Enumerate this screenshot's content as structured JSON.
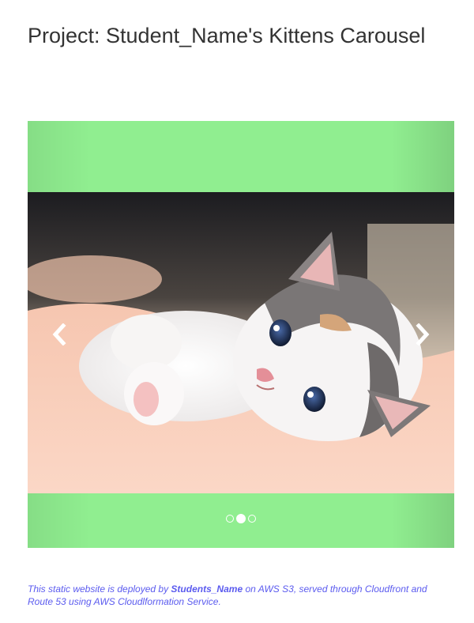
{
  "header": {
    "title": "Project: Student_Name's Kittens Carousel"
  },
  "carousel": {
    "background_color": "#90ee90",
    "prev_icon": "chevron-left-icon",
    "next_icon": "chevron-right-icon",
    "indicator_count": 3,
    "active_index": 1,
    "slide_alt": "kitten"
  },
  "footer": {
    "text_before": "This static website is deployed by ",
    "name": "Students_Name",
    "text_after": " on AWS S3, served through Cloudfront and Route 53 using AWS Cloudlformation Service.",
    "color": "#5b5bef"
  }
}
